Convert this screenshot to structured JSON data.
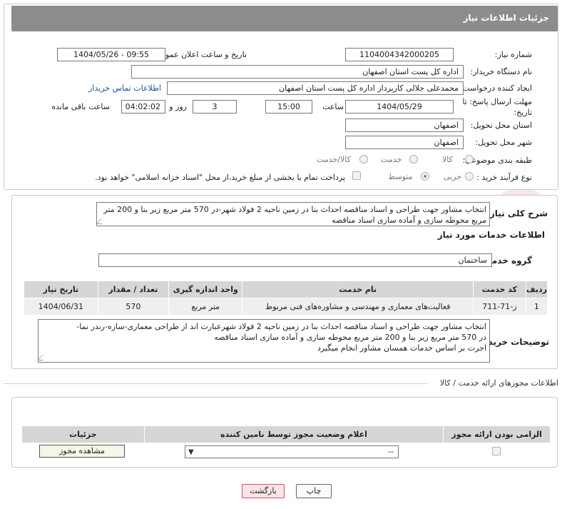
{
  "header": {
    "title": "جزئیات اطلاعات نیاز"
  },
  "form": {
    "need_number_label": "شماره نیاز:",
    "need_number": "1104004342000205",
    "announce_label": "تاریخ و ساعت اعلان عمومی:",
    "announce_value": "1404/05/26 - 09:55",
    "buyer_org_label": "نام دستگاه خریدار:",
    "buyer_org": "اداره کل پست استان اصفهان",
    "creator_label": "ایجاد کننده درخواست:",
    "creator": "محمدعلی جلالی کارپرداز اداره کل پست استان اصفهان",
    "contact_link": "اطلاعات تماس خریدار",
    "deadline_label": "مهلت ارسال پاسخ: تا تاریخ:",
    "deadline_date": "1404/05/29",
    "time_label": "ساعت",
    "deadline_time": "15:00",
    "days_value": "3",
    "days_label": "روز و",
    "remaining_time": "04:02:02",
    "remaining_label": "ساعت باقی مانده",
    "province_label": "استان محل تحویل:",
    "province": "اصفهان",
    "city_label": "شهر محل تحویل:",
    "city": "اصفهان",
    "category_label": "طبقه بندی موضوعی:",
    "category_options": [
      "کالا",
      "خدمت",
      "کالا/خدمت"
    ],
    "process_label": "نوع فرآیند خرید :",
    "process_options": [
      "جزیی",
      "متوسط"
    ],
    "payment_note": "پرداخت تمام یا بخشی از مبلغ خرید،از محل \"اسناد خزانه اسلامی\" خواهد بود."
  },
  "details": {
    "summary_label": "شرح کلی نیاز:",
    "summary": "انتخاب مشاور جهت طراحی و اسناد مناقصه احداث بنا در زمین ناحیه 2 فولاد شهر-در 570 متر مربع زیر بنا و 200 متر مربع محوطه سازی و آماده سازی اسناد مناقصه",
    "services_title": "اطلاعات خدمات مورد نیاز",
    "service_group_label": "گروه خدمت:",
    "service_group": "ساختمان",
    "table": {
      "headers": [
        "ردیف",
        "کد خدمت",
        "نام خدمت",
        "واحد اندازه گیری",
        "تعداد / مقدار",
        "تاریخ نیاز"
      ],
      "rows": [
        [
          "1",
          "ز-71-711",
          "فعالیت‌های معماری و مهندسی و مشاوره‌های فنی مربوط",
          "متر مربع",
          "570",
          "1404/06/31"
        ]
      ]
    },
    "buyer_notes_label": "توضیحات خریدار:",
    "buyer_notes_line1": "انتخاب مشاور جهت طراحی و اسناد مناقصه احداث بنا در زمین ناحیه 2 فولاد شهرعبارت اند از طراحی معماری-سازه-رندر نما-",
    "buyer_notes_line2": "در 570 متر مربع زیر بنا و 200 متر مربع محوطه سازی و آماده سازی اسناد مناقصه",
    "buyer_notes_line3": "اجرت بر اساس خدمات همسان مشاور انجام میگیرد"
  },
  "permits": {
    "section_title": "اطلاعات مجوزهای ارائه خدمت / کالا",
    "headers": [
      "الزامی بودن ارائه مجوز",
      "اعلام وضعیت مجوز توسط نامین کننده",
      "جزئیات"
    ],
    "select_value": "--",
    "view_button": "مشاهده مجوز"
  },
  "actions": {
    "print": "چاپ",
    "back": "بازگشت"
  },
  "watermark_text": "AriaTender.neT",
  "colors": {
    "header_bg": "#8c8c8c",
    "link": "#1a4fa0",
    "back_button": "#fbe4e6"
  }
}
